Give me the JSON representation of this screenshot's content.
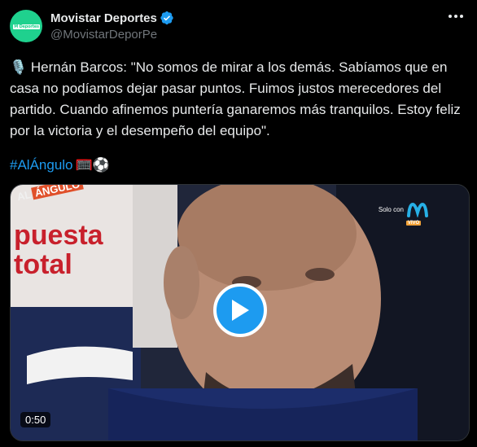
{
  "author": {
    "display_name": "Movistar Deportes",
    "handle": "@MovistarDeporPe",
    "avatar_text": "M Deportes"
  },
  "tweet": {
    "text": "🎙️ Hernán Barcos: \"No somos de mirar a los demás. Sabíamos que en casa no podíamos dejar pasar puntos. Fuimos justos merecedores del partido. Cuando afinemos puntería ganaremos más tranquilos. Estoy feliz por la victoria y el desempeño del equipo\".",
    "hashtag": "#AlÁngulo",
    "emojis": "🥅⚽"
  },
  "video": {
    "duration": "0:50",
    "show_logo_al": "AL",
    "show_logo_angulo": "ÁNGULO",
    "watermark_solo": "Solo con",
    "watermark_vivo": "VIVO",
    "background_sign_1": "puesta",
    "background_sign_2": "total"
  },
  "colors": {
    "background": "#000000",
    "text": "#e7e9ea",
    "secondary": "#71767b",
    "link": "#1d9bf0",
    "avatar": "#1fd18e"
  },
  "icons": {
    "verified": "verified-badge-icon",
    "more": "more-options-icon",
    "play": "play-icon",
    "mic": "microphone-icon"
  }
}
